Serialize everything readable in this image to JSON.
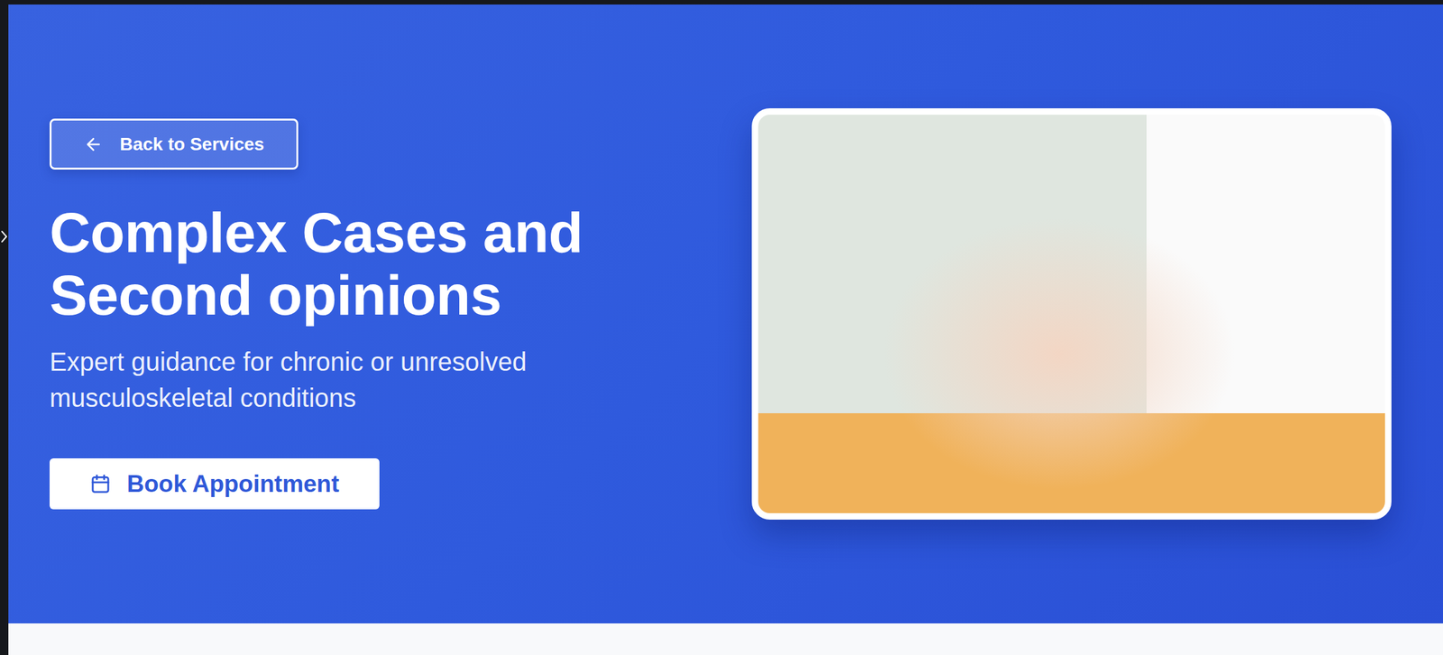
{
  "back_link": {
    "label": "Back to Services"
  },
  "hero": {
    "title": "Complex Cases and Second opinions",
    "subtitle": "Expert guidance for chronic or unresolved musculoskeletal conditions"
  },
  "book_button": {
    "label": "Book Appointment"
  }
}
